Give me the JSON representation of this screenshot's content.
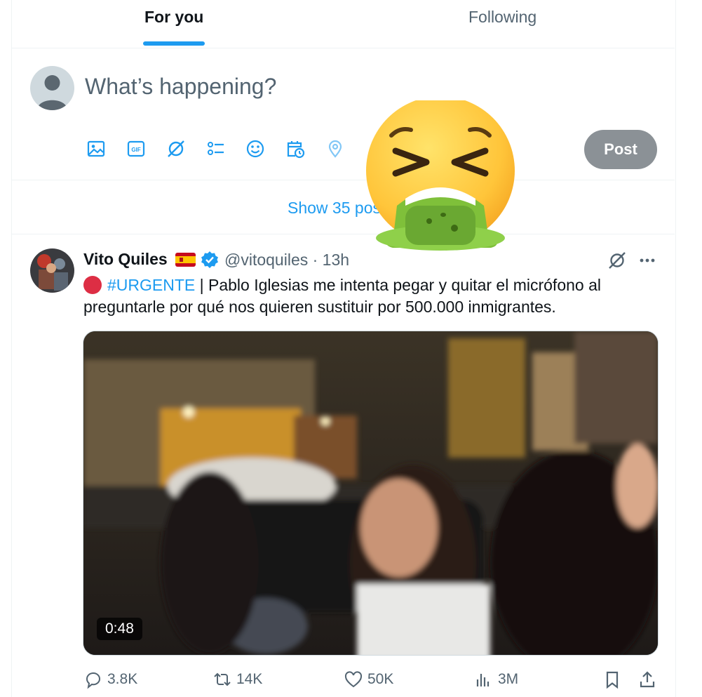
{
  "tabs": [
    {
      "label": "For you",
      "active": true
    },
    {
      "label": "Following",
      "active": false
    }
  ],
  "compose": {
    "placeholder": "What’s happening?",
    "tools": [
      "image-icon",
      "gif-icon",
      "grok-icon",
      "poll-icon",
      "emoji-icon",
      "schedule-icon",
      "location-icon"
    ],
    "post_label": "Post"
  },
  "show_posts": "Show 35 posts",
  "sticker": "nauseated-vomiting-face-emoji",
  "tweet": {
    "author_name": "Vito Quiles",
    "flag": "spain-flag",
    "handle_time": "@vitoquiles · 13h",
    "hashtag": "#URGENTE",
    "text": " | Pablo Iglesias me intenta pegar y quitar el micrófono al preguntarle por qué nos quieren sustituir por 500.000 inmigrantes.",
    "video_duration": "0:48",
    "replies": "3.8K",
    "reposts": "14K",
    "likes": "50K",
    "views": "3M"
  },
  "colors": {
    "accent": "#1d9bf0",
    "text_secondary": "#536471",
    "post_button_disabled": "#8b9196"
  }
}
